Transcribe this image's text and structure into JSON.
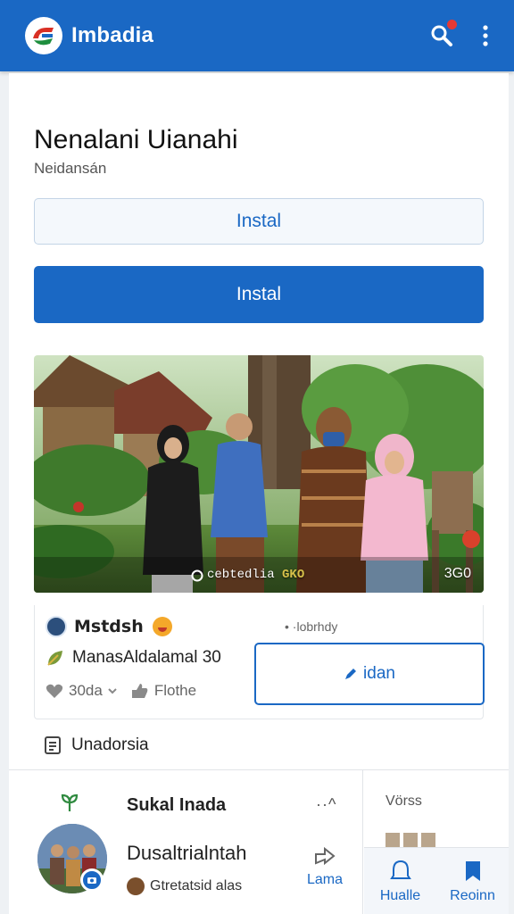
{
  "appbar": {
    "title": "Imbadia",
    "logo_icon": "app-logo",
    "search_icon": "search-icon",
    "more_icon": "more-vert-icon",
    "notification_dot_color": "#e53935"
  },
  "colors": {
    "primary": "#1a68c4",
    "outline": "#c3d4e6"
  },
  "listing": {
    "name": "Nenalani Uianahi",
    "subtitle": "Neidansán",
    "install_outline_label": "Instal",
    "install_primary_label": "Instal"
  },
  "media": {
    "overlay_text": "cebtedlia",
    "overlay_tag": "GKO",
    "overlay_count": "3G0"
  },
  "post": {
    "author": "Mstdsh",
    "time": "• ·lobrhdy",
    "rating_text": "ManasAldalamal 30",
    "likes": "30da",
    "reaction_label": "Flothe",
    "edit_label": "idan"
  },
  "info_row": {
    "label": "Unadorsia"
  },
  "bottom": {
    "title": "Sukal Inada",
    "collapse_glyph": "··^",
    "heading": "Dusaltrialntah",
    "sub_text": "Gtretatsid alas",
    "share_label": "Lama",
    "side_label": "Vörss",
    "nav": [
      {
        "label": "Hualle",
        "icon": "bell-icon"
      },
      {
        "label": "Reoinn",
        "icon": "bookmark-icon"
      }
    ]
  }
}
